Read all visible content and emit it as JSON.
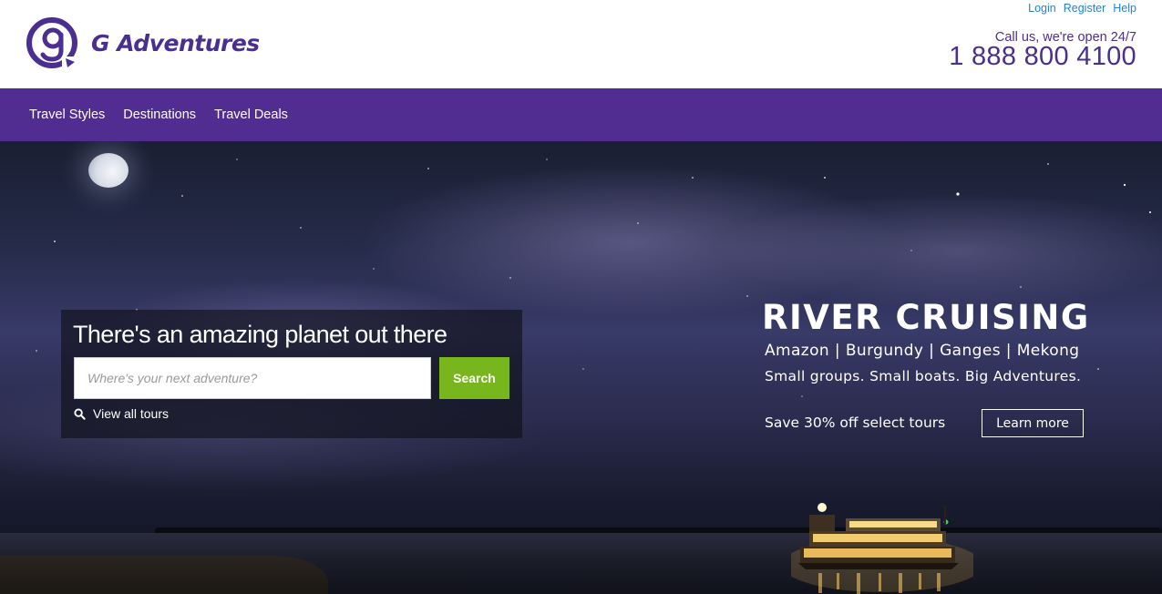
{
  "brand": {
    "name": "G Adventures",
    "color": "#4b2e91",
    "logo_icon": "g-adventures-logo-icon"
  },
  "utility_links": [
    {
      "label": "Login"
    },
    {
      "label": "Register"
    },
    {
      "label": "Help"
    }
  ],
  "contact": {
    "callout": "Call us, we're open 24/7",
    "phone": "1 888 800 4100"
  },
  "nav": {
    "background": "#512d92",
    "items": [
      {
        "label": "Travel Styles"
      },
      {
        "label": "Destinations"
      },
      {
        "label": "Travel Deals"
      }
    ]
  },
  "search": {
    "heading": "There's an amazing planet out there",
    "placeholder": "Where's your next adventure?",
    "value": "",
    "button_label": "Search",
    "button_color": "#78b61d",
    "view_all_label": "View all tours",
    "view_all_icon": "magnifier-icon"
  },
  "promo": {
    "title": "RIVER CRUISING",
    "destinations": "Amazon | Burgundy | Ganges | Mekong",
    "tagline": "Small groups. Small boats. Big Adventures.",
    "offer": "Save 30% off select tours",
    "cta_label": "Learn more"
  }
}
